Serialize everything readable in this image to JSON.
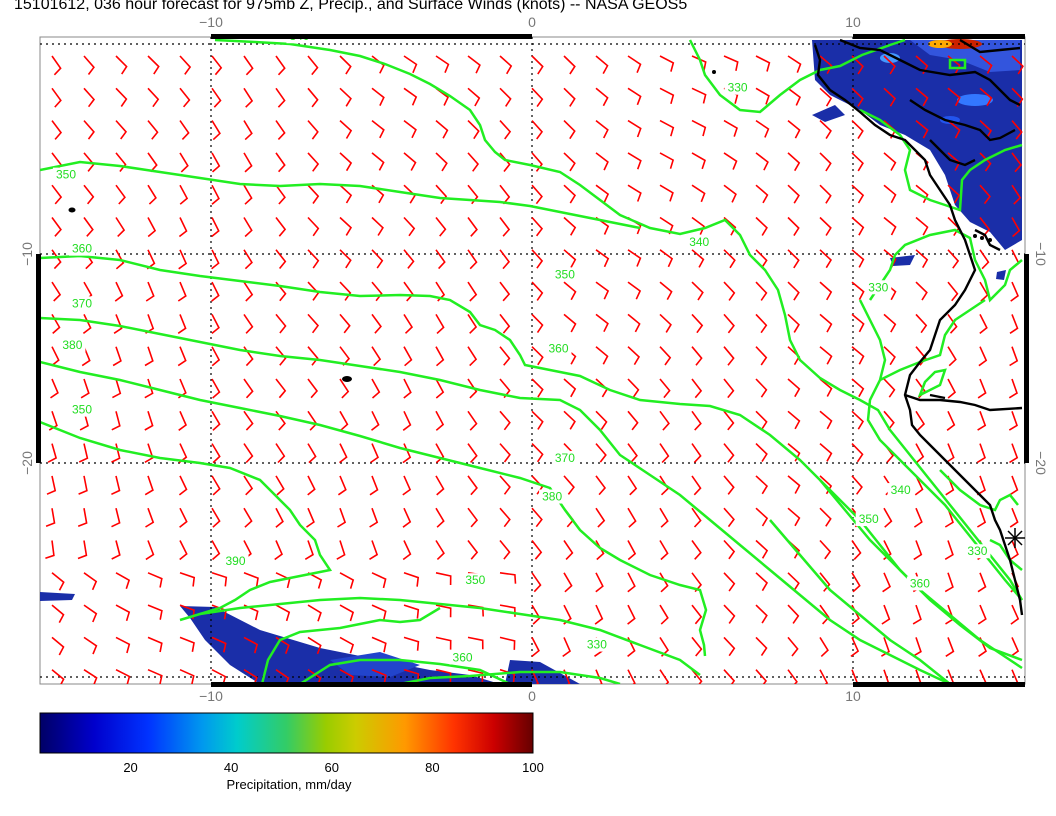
{
  "title": "15101612, 036 hour forecast for 975mb Z, Precip., and Surface Winds (knots) -- NASA GEOS5",
  "colors": {
    "wind_barbs": "#ff0000",
    "height_contours": "#22ee22",
    "coastline": "#000000",
    "grid": "#000000",
    "colorbar": [
      "#000066",
      "#0000cc",
      "#0066ff",
      "#00cccc",
      "#66cc33",
      "#cccc00",
      "#ff9900",
      "#ff3300",
      "#cc0000",
      "#660000"
    ]
  },
  "map": {
    "lon_range": [
      -15.5,
      15.3
    ],
    "lat_range": [
      -29.5,
      -9.4
    ],
    "grid_lons": [
      -10,
      0,
      10
    ],
    "grid_lats": [
      -10,
      -20
    ],
    "lon_tick_labels": [
      "−10",
      "0",
      "10"
    ],
    "lat_tick_labels": [
      "−10",
      "−20"
    ],
    "contour_labels": [
      {
        "text": "340",
        "lon": -7.7,
        "lat": -9.5
      },
      {
        "text": "330",
        "lon": 6.0,
        "lat": -11.1
      },
      {
        "text": "350",
        "lon": -15.0,
        "lat": -13.8
      },
      {
        "text": "340",
        "lon": 4.8,
        "lat": -15.9
      },
      {
        "text": "360",
        "lon": -14.5,
        "lat": -16.1
      },
      {
        "text": "350",
        "lon": 0.6,
        "lat": -16.9
      },
      {
        "text": "330",
        "lon": 10.4,
        "lat": -17.3
      },
      {
        "text": "370",
        "lon": -14.5,
        "lat": -17.8
      },
      {
        "text": "380",
        "lon": -14.8,
        "lat": -19.1
      },
      {
        "text": "360",
        "lon": 0.4,
        "lat": -19.2
      },
      {
        "text": "350",
        "lon": -14.5,
        "lat": -21.1
      },
      {
        "text": "370",
        "lon": 0.6,
        "lat": -22.6
      },
      {
        "text": "380",
        "lon": 0.2,
        "lat": -23.8
      },
      {
        "text": "340",
        "lon": 11.1,
        "lat": -23.6
      },
      {
        "text": "350",
        "lon": 10.1,
        "lat": -24.5
      },
      {
        "text": "330",
        "lon": 13.5,
        "lat": -25.5
      },
      {
        "text": "360",
        "lon": 11.7,
        "lat": -26.5
      },
      {
        "text": "390",
        "lon": -9.7,
        "lat": -25.8
      },
      {
        "text": "350",
        "lon": -2.2,
        "lat": -26.4
      },
      {
        "text": "360",
        "lon": -2.6,
        "lat": -28.8
      },
      {
        "text": "330",
        "lon": 1.6,
        "lat": -28.4
      }
    ]
  },
  "colorbar": {
    "label": "Precipitation, mm/day",
    "range": [
      2,
      100
    ],
    "ticks": [
      "20",
      "40",
      "60",
      "80",
      "100"
    ],
    "tick_values": [
      20,
      40,
      60,
      80,
      100
    ]
  }
}
